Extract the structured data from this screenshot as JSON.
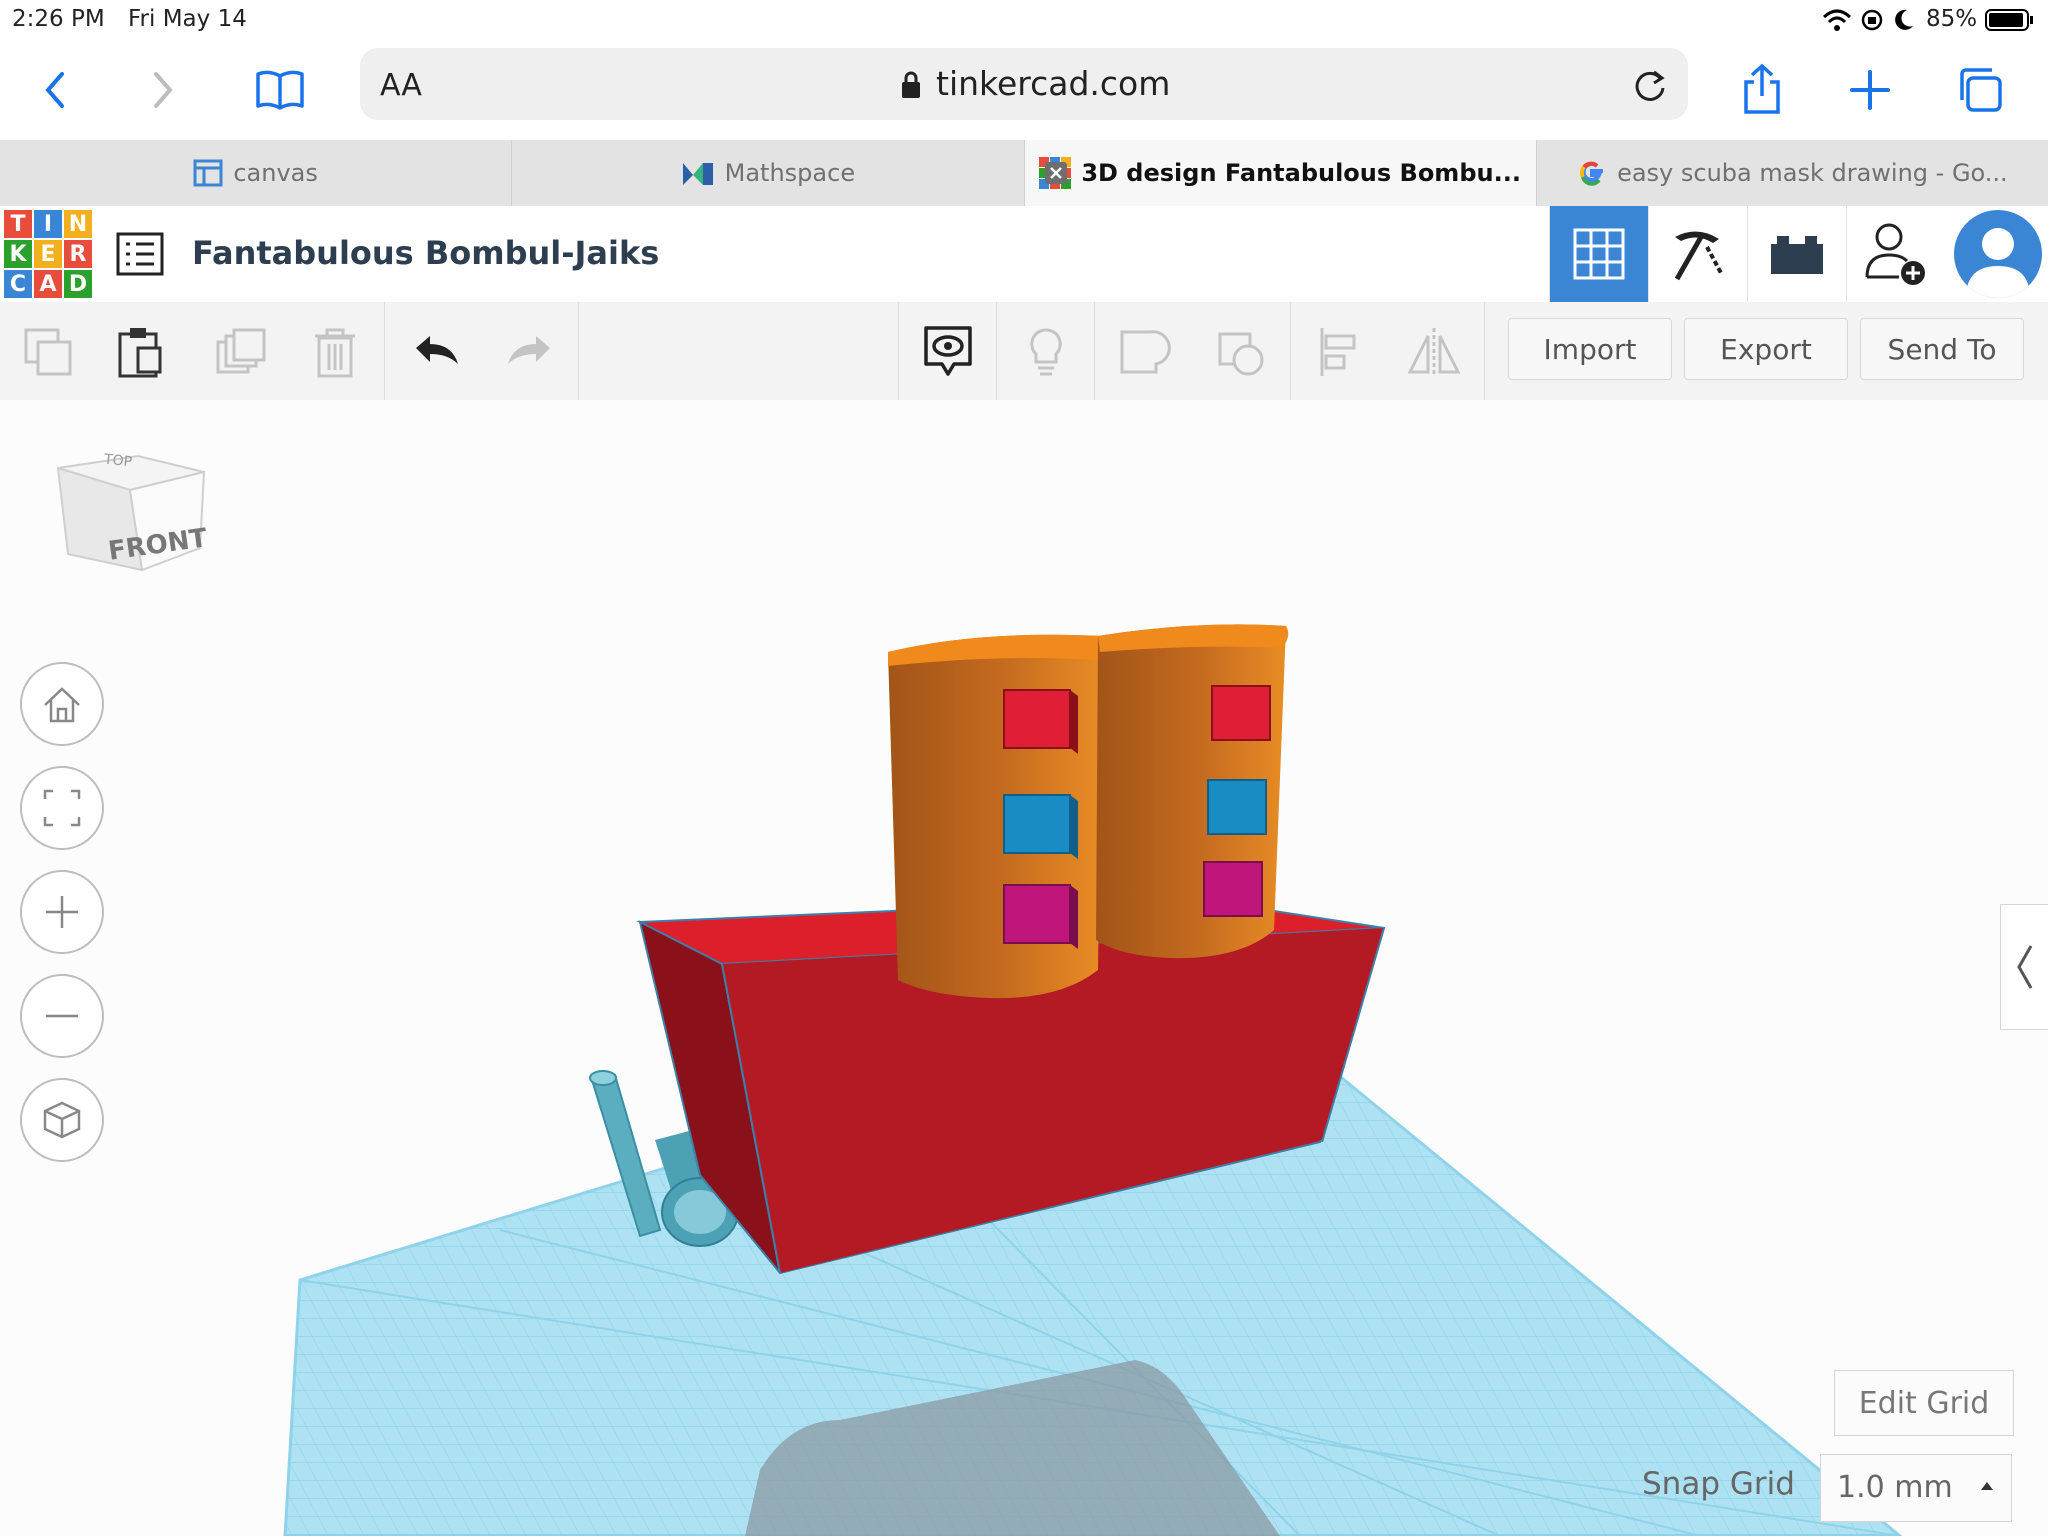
{
  "status_bar": {
    "time": "2:26 PM",
    "date": "Fri May 14",
    "battery": "85%"
  },
  "safari": {
    "text_size_label": "AA",
    "url": "tinkercad.com"
  },
  "tabs": [
    {
      "label": "canvas",
      "icon": "canvas-icon",
      "active": false
    },
    {
      "label": "Mathspace",
      "icon": "mathspace-logo-icon",
      "active": false
    },
    {
      "label": "3D design Fantabulous Bombu...",
      "icon": "tinkercad-logo-icon",
      "active": true
    },
    {
      "label": "easy scuba mask drawing - Go...",
      "icon": "google-logo-icon",
      "active": false
    }
  ],
  "header": {
    "logo_letters": [
      "T",
      "I",
      "N",
      "K",
      "E",
      "R",
      "C",
      "A",
      "D"
    ],
    "title": "Fantabulous Bombul-Jaiks"
  },
  "toolbar": {
    "import_label": "Import",
    "export_label": "Export",
    "sendto_label": "Send To"
  },
  "viewcube": {
    "top_label": "TOP",
    "front_label": "FRONT"
  },
  "workplane": {
    "edit_grid_label": "Edit Grid",
    "snap_grid_label": "Snap Grid",
    "snap_grid_value": "1.0 mm"
  },
  "colors": {
    "accent": "#3a86d4",
    "box_red": "#b41a24",
    "orange": "#e6821e",
    "grid_blue": "#a5def0"
  }
}
